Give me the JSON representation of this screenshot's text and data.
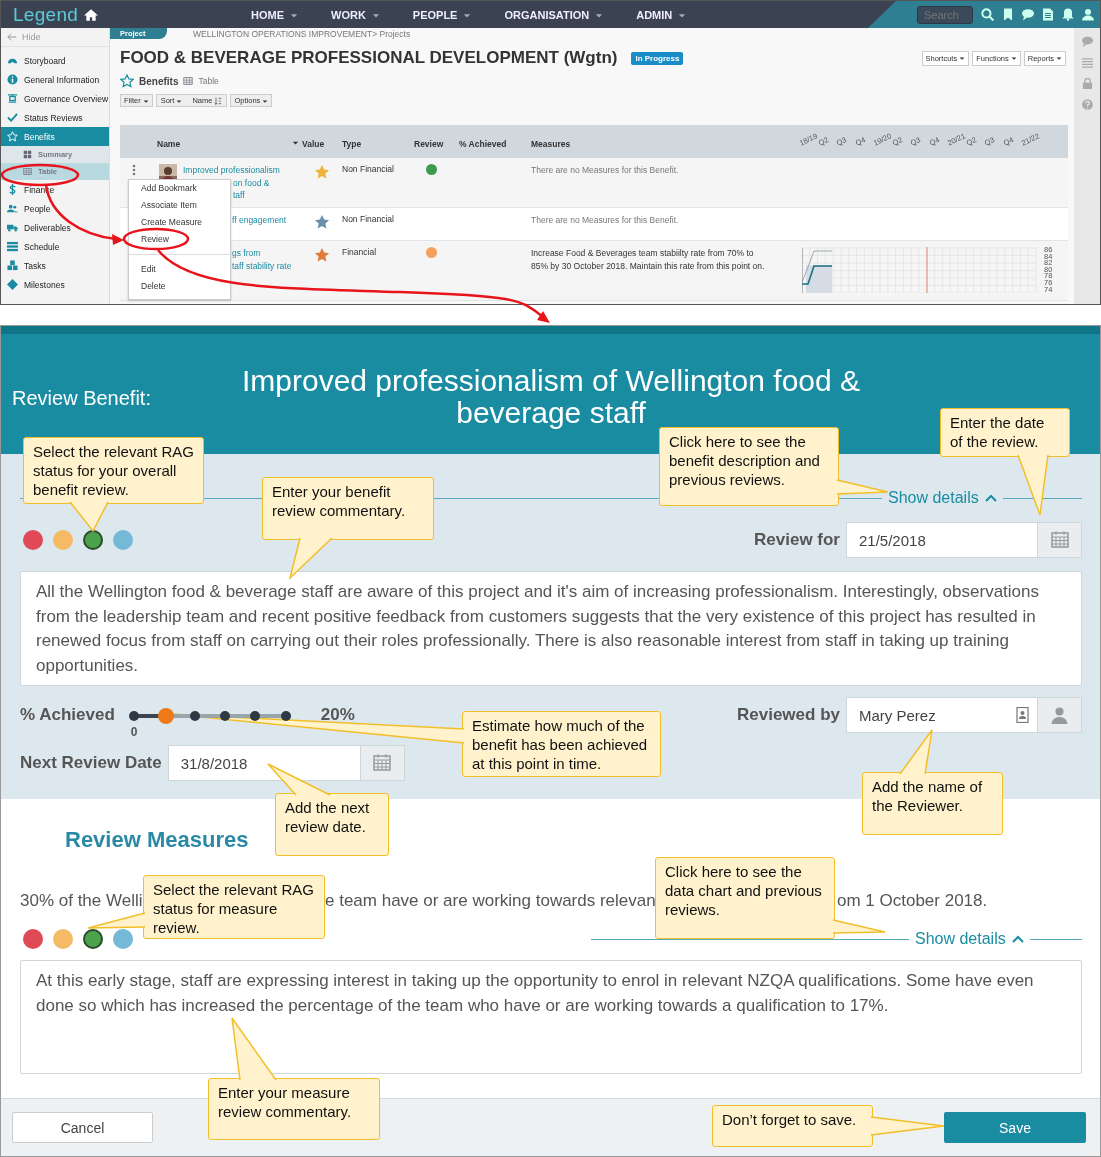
{
  "topbar": {
    "logo": "Legend",
    "menu": [
      {
        "label": "HOME"
      },
      {
        "label": "WORK"
      },
      {
        "label": "PEOPLE"
      },
      {
        "label": "ORGANISATION"
      },
      {
        "label": "ADMIN"
      }
    ],
    "search": {
      "placeholder": "Search"
    }
  },
  "sidebar": {
    "hide": "Hide",
    "items": [
      {
        "label": "Storyboard",
        "selected": false
      },
      {
        "label": "General Information",
        "selected": false
      },
      {
        "label": "Governance Overview",
        "selected": false
      },
      {
        "label": "Status Reviews",
        "selected": false
      },
      {
        "label": "Benefits",
        "selected": true,
        "children": [
          {
            "label": "Summary",
            "selected": false
          },
          {
            "label": "Table",
            "selected": true
          }
        ]
      },
      {
        "label": "Finance",
        "selected": false
      },
      {
        "label": "People",
        "selected": false
      },
      {
        "label": "Deliverables",
        "selected": false
      },
      {
        "label": "Schedule",
        "selected": false
      },
      {
        "label": "Tasks",
        "selected": false
      },
      {
        "label": "Milestones",
        "selected": false
      }
    ]
  },
  "page": {
    "tab": "Project",
    "breadcrumb": "WELLINGTON OPERATIONS IMPROVEMENT> Projects",
    "title": "FOOD & BEVERAGE PROFESSIONAL DEVELOPMENT (Wgtn)",
    "status": "In Progress",
    "actions": [
      "Shortcuts",
      "Functions",
      "Reports"
    ],
    "section": "Benefits",
    "view": "Table",
    "filter": "Filter",
    "sort": "Sort",
    "sort_field": "Name",
    "options": "Options"
  },
  "table": {
    "columns": [
      "Name",
      "Value",
      "Type",
      "Review",
      "% Achieved",
      "Measures"
    ],
    "timeline": [
      "18/19",
      "Q2",
      "Q3",
      "Q4",
      "19/20",
      "Q2",
      "Q3",
      "Q4",
      "20/21",
      "Q2",
      "Q3",
      "Q4",
      "21/22"
    ],
    "rows": [
      {
        "avatar": {
          "kind": "picture"
        },
        "name_lines": [
          "Improved professionalism",
          "on food &",
          "taff"
        ],
        "value": {
          "color": "#f0b23c"
        },
        "type": "Non Financial",
        "review": {
          "color": "#3e9a4f"
        },
        "measures": {
          "kind": "none",
          "text": "There are no Measures for this Benefit."
        }
      },
      {
        "name_lines": [
          "ff engagement"
        ],
        "value": {
          "color": "#6b8fa8"
        },
        "type": "Non Financial",
        "measures": {
          "kind": "none",
          "text": "There are no Measures for this Benefit."
        }
      },
      {
        "name_lines": [
          "gs from",
          "taff stability rate"
        ],
        "value": {
          "color": "#e07b39"
        },
        "type": "Financial",
        "review": {
          "color": "#f5a05a"
        },
        "measures": {
          "kind": "text",
          "text": "Increase Food & Beverages team stabiilty rate from 70% to 85% by 30 October 2018. Maintain this rate from this point on."
        },
        "trend": {
          "y_labels": [
            "86",
            "84",
            "82",
            "80",
            "78",
            "76",
            "74"
          ]
        }
      }
    ]
  },
  "context_menu": {
    "groups": [
      [
        "Add Bookmark",
        "Associate Item",
        "Create Measure",
        "Review"
      ],
      [
        "Edit",
        "Delete"
      ]
    ]
  },
  "dialog": {
    "label": "Review Benefit:",
    "title": "Improved professionalism of Wellington food & beverage staff",
    "review": {
      "show_details": "Show details",
      "rag": [
        {
          "color": "#e04a57",
          "selected": false
        },
        {
          "color": "#f6b965",
          "selected": false
        },
        {
          "color": "#4aa24a",
          "selected": true
        },
        {
          "color": "#74b9d6",
          "selected": false
        }
      ],
      "review_for": {
        "label": "Review for",
        "value": "21/5/2018"
      },
      "commentary": "All the Wellington food & beverage staff are aware of this project and it's aim of increasing professionalism.  Interestingly, observations from the leadership team and recent positive feedback from customers suggests that the very existence of this project has resulted in renewed focus from staff on carrying out their roles professionally. There is also reasonable interest from staff in taking up training opportunities.",
      "achieved": {
        "label": "% Achieved",
        "level": 0.2,
        "reading": "20%",
        "min_label": "0"
      },
      "reviewed_by": {
        "label": "Reviewed by",
        "value": "Mary Perez"
      },
      "next_review": {
        "label": "Next Review Date",
        "value": "31/8/2018"
      }
    },
    "measures": {
      "heading": "Review Measures",
      "description_parts": [
        "30% of the Welli",
        "e team have or are working towards relevan",
        "om 1 October 2018."
      ],
      "rag": [
        {
          "color": "#e04a57",
          "selected": false
        },
        {
          "color": "#f6b965",
          "selected": false
        },
        {
          "color": "#4aa24a",
          "selected": true
        },
        {
          "color": "#74b9d6",
          "selected": false
        }
      ],
      "show_details": "Show details",
      "commentary": "At this early stage, staff are expressing interest in taking up the opportunity to enrol in relevant NZQA qualifications.  Some have even done so which has increased the percentage of the team who have or are working towards a qualification to 17%."
    },
    "buttons": [
      {
        "label": "Cancel",
        "kind": "secondary"
      },
      {
        "label": "Save",
        "kind": "primary"
      }
    ]
  },
  "callouts": [
    {
      "text": "Select the relevant RAG status for your overall benefit review."
    },
    {
      "text": "Enter your benefit review commentary."
    },
    {
      "text": "Click here to see the benefit description and previous reviews."
    },
    {
      "text": "Enter the date of the review."
    },
    {
      "text": "Estimate how much of the benefit has been achieved at this point in time."
    },
    {
      "text": "Add the name of the Reviewer."
    },
    {
      "text": "Add the next review date."
    },
    {
      "text": "Select the relevant RAG status for measure review."
    },
    {
      "text": "Click here to see the data chart and previous reviews."
    },
    {
      "text": "Enter your measure review commentary."
    },
    {
      "text": "Don’t forget to save."
    }
  ]
}
